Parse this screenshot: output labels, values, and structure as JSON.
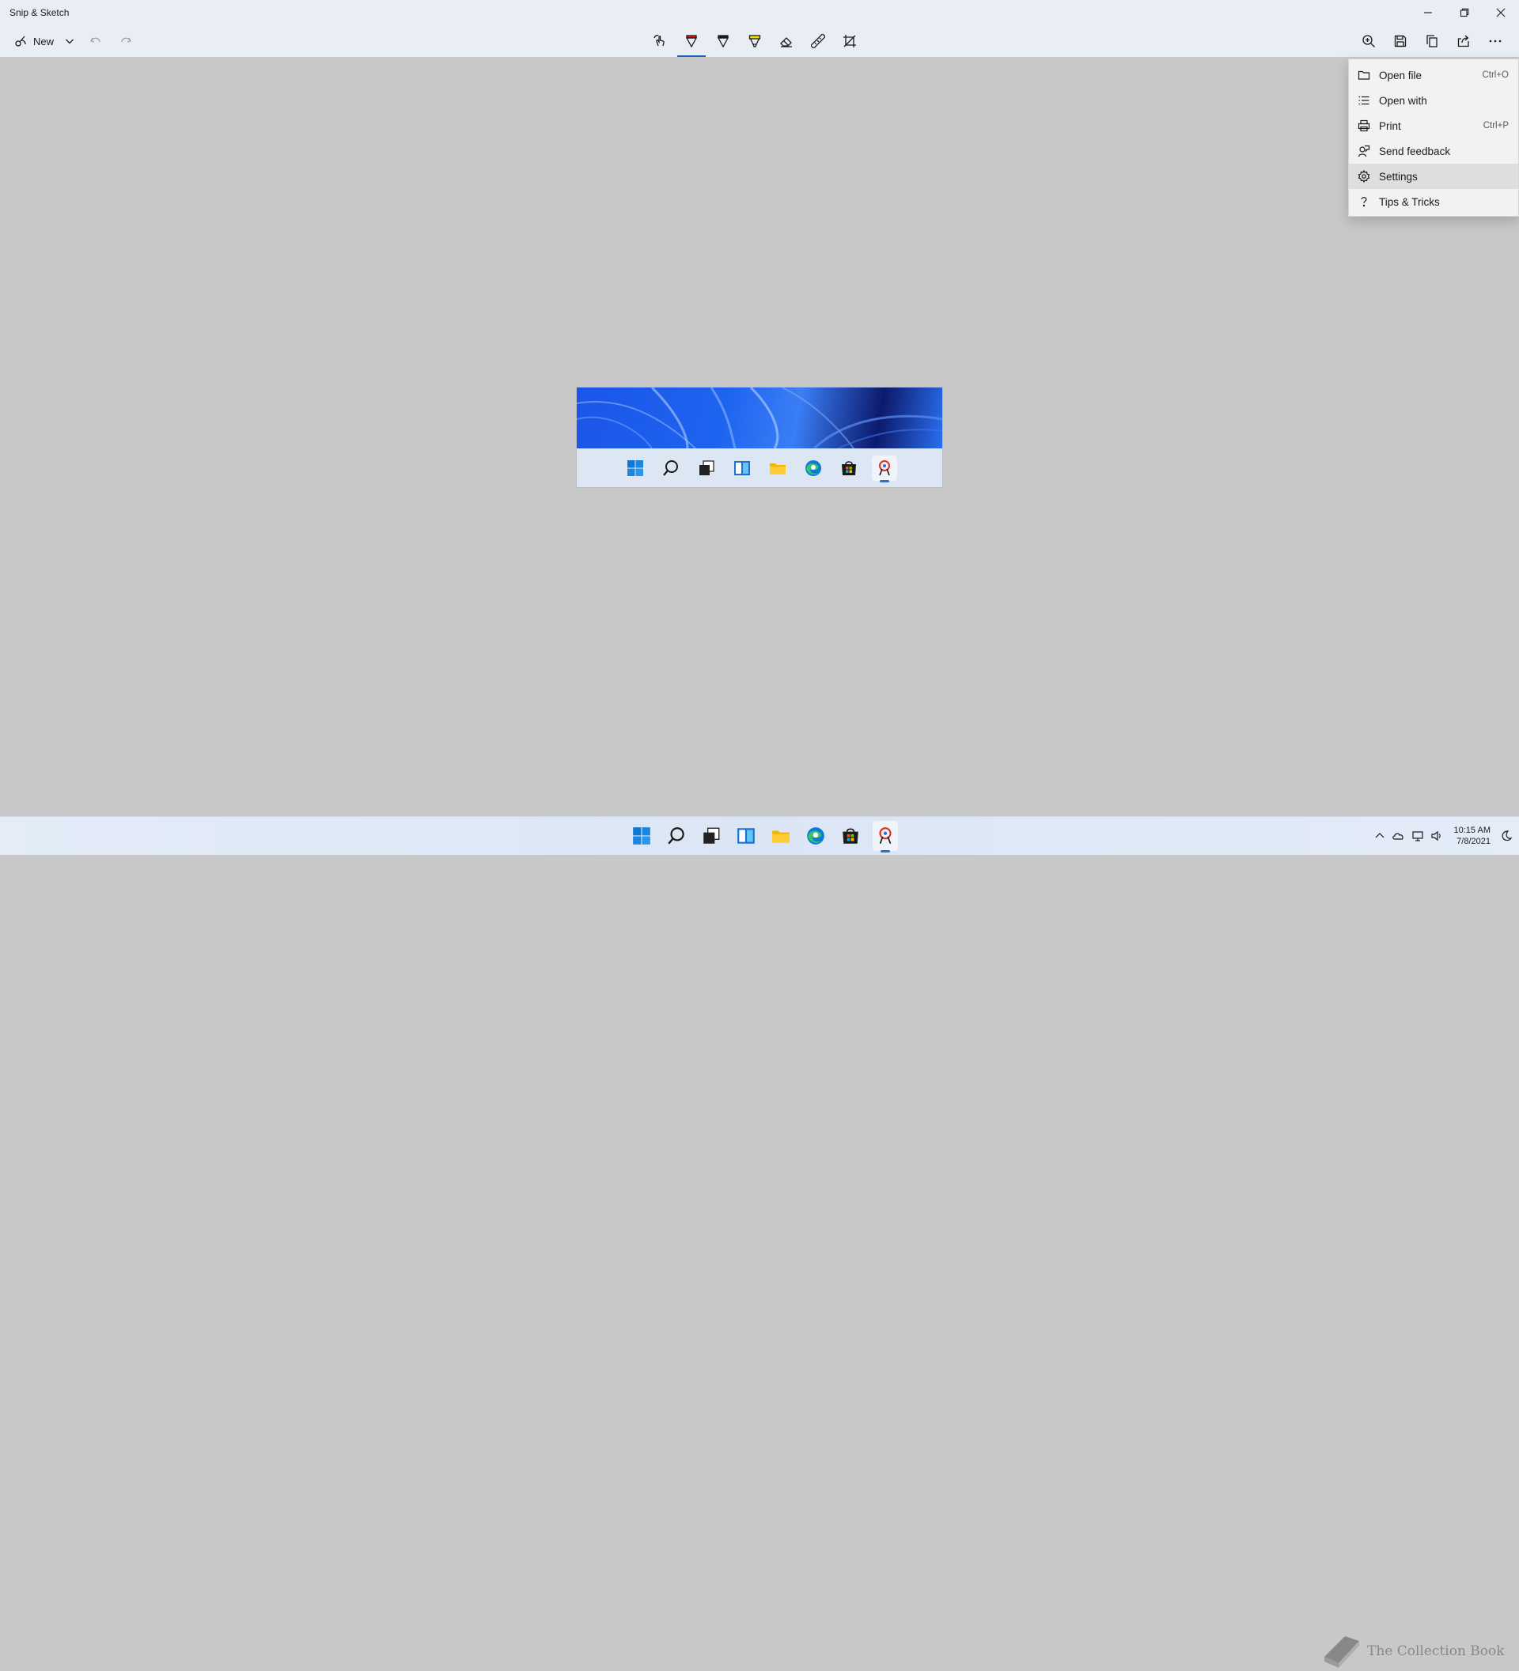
{
  "window": {
    "title": "Snip & Sketch"
  },
  "toolbar": {
    "new_label": "New",
    "tools": [
      {
        "name": "touch-writing-icon"
      },
      {
        "name": "ballpoint-pen-icon",
        "active": true
      },
      {
        "name": "pencil-icon"
      },
      {
        "name": "highlighter-icon"
      },
      {
        "name": "eraser-icon"
      },
      {
        "name": "ruler-icon"
      },
      {
        "name": "crop-icon"
      }
    ],
    "right_actions": [
      "zoom-icon",
      "save-icon",
      "copy-icon",
      "share-icon",
      "more-icon"
    ]
  },
  "menu": {
    "items": [
      {
        "label": "Open file",
        "shortcut": "Ctrl+O",
        "icon": "folder-icon"
      },
      {
        "label": "Open with",
        "shortcut": "",
        "icon": "list-icon"
      },
      {
        "label": "Print",
        "shortcut": "Ctrl+P",
        "icon": "printer-icon"
      },
      {
        "label": "Send feedback",
        "shortcut": "",
        "icon": "feedback-icon"
      },
      {
        "label": "Settings",
        "shortcut": "",
        "icon": "gear-icon",
        "highlighted": true
      },
      {
        "label": "Tips & Tricks",
        "shortcut": "",
        "icon": "question-icon"
      }
    ]
  },
  "taskbar": {
    "icons": [
      "windows-start-icon",
      "search-icon",
      "task-view-icon",
      "widgets-icon",
      "file-explorer-icon",
      "edge-icon",
      "store-icon",
      "snip-sketch-icon"
    ],
    "clock": {
      "time": "10:15 AM",
      "date": "7/8/2021"
    }
  },
  "watermark": {
    "text": "The Collection Book"
  },
  "colors": {
    "accent": "#1f5fc2",
    "canvas": "#c8c8c8",
    "chrome": "#e8eef4"
  }
}
